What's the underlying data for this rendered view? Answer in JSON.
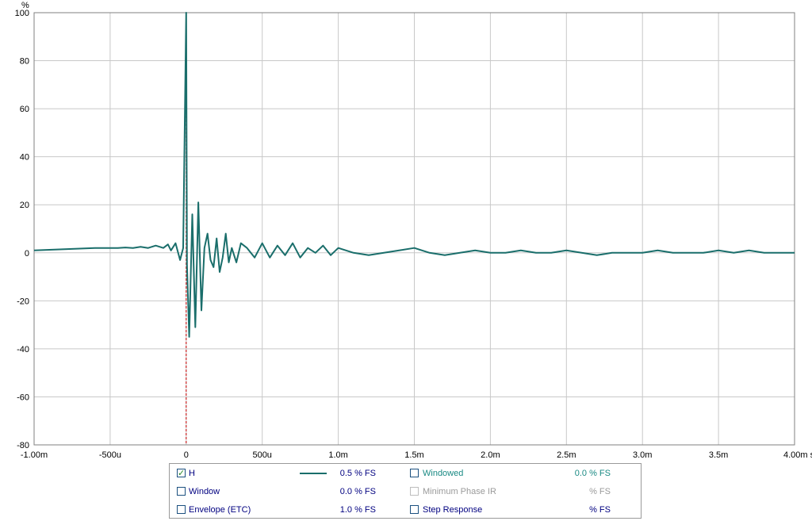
{
  "chart_data": {
    "type": "line",
    "ylabel": "%",
    "x_unit": "s",
    "xlim": [
      -0.001,
      0.004
    ],
    "ylim": [
      -80,
      100
    ],
    "grid": true,
    "x_ticks": [
      {
        "value": -0.001,
        "label": "-1.00m"
      },
      {
        "value": -0.0005,
        "label": "-500u"
      },
      {
        "value": 0,
        "label": "0"
      },
      {
        "value": 0.0005,
        "label": "500u"
      },
      {
        "value": 0.001,
        "label": "1.0m"
      },
      {
        "value": 0.0015,
        "label": "1.5m"
      },
      {
        "value": 0.002,
        "label": "2.0m"
      },
      {
        "value": 0.0025,
        "label": "2.5m"
      },
      {
        "value": 0.003,
        "label": "3.0m"
      },
      {
        "value": 0.0035,
        "label": "3.5m"
      },
      {
        "value": 0.004,
        "label": "4.00m s"
      }
    ],
    "y_ticks": [
      {
        "value": 100,
        "label": "100"
      },
      {
        "value": 80,
        "label": "80"
      },
      {
        "value": 60,
        "label": "60"
      },
      {
        "value": 40,
        "label": "40"
      },
      {
        "value": 20,
        "label": "20"
      },
      {
        "value": 0,
        "label": "0"
      },
      {
        "value": -20,
        "label": "-20"
      },
      {
        "value": -40,
        "label": "-40"
      },
      {
        "value": -60,
        "label": "-60"
      },
      {
        "value": -80,
        "label": "-80"
      }
    ],
    "marker_x": 0,
    "series": [
      {
        "name": "H",
        "color": "#1a6e6b",
        "x": [
          -0.001,
          -0.0008,
          -0.0006,
          -0.0005,
          -0.00045,
          -0.0004,
          -0.00035,
          -0.0003,
          -0.00025,
          -0.0002,
          -0.00015,
          -0.00012,
          -0.0001,
          -7e-05,
          -4e-05,
          -2e-05,
          0,
          5e-06,
          2e-05,
          4e-05,
          6e-05,
          8e-05,
          0.0001,
          0.00012,
          0.00014,
          0.00016,
          0.00018,
          0.0002,
          0.00022,
          0.00024,
          0.00026,
          0.00028,
          0.0003,
          0.00033,
          0.00036,
          0.0004,
          0.00045,
          0.0005,
          0.00055,
          0.0006,
          0.00065,
          0.0007,
          0.00075,
          0.0008,
          0.00085,
          0.0009,
          0.00095,
          0.001,
          0.0011,
          0.0012,
          0.0013,
          0.0014,
          0.0015,
          0.0016,
          0.0017,
          0.0018,
          0.0019,
          0.002,
          0.0021,
          0.0022,
          0.0023,
          0.0024,
          0.0025,
          0.0026,
          0.0027,
          0.0028,
          0.0029,
          0.003,
          0.0031,
          0.0032,
          0.0033,
          0.0034,
          0.0035,
          0.0036,
          0.0037,
          0.0038,
          0.0039,
          0.004
        ],
        "y": [
          1,
          1.5,
          2,
          2,
          2,
          2.2,
          2,
          2.5,
          2,
          3,
          2,
          3.5,
          1,
          4,
          -3,
          2,
          100,
          -5,
          -35,
          16,
          -31,
          21,
          -24,
          2,
          8,
          -3,
          -6,
          6,
          -8,
          -2,
          8,
          -4,
          2,
          -4,
          4,
          2,
          -2,
          4,
          -2,
          3,
          -1,
          4,
          -2,
          2,
          0,
          3,
          -1,
          2,
          0,
          -1,
          0,
          1,
          2,
          0,
          -1,
          0,
          1,
          0,
          0,
          1,
          0,
          0,
          1,
          0,
          -1,
          0,
          0,
          0,
          1,
          0,
          0,
          0,
          1,
          0,
          1,
          0,
          0,
          0
        ]
      }
    ]
  },
  "legend": {
    "items": [
      {
        "label": "H",
        "checked": true,
        "value": "0.5 % FS",
        "label_color": "#000080",
        "value_color": "#000080",
        "swatch": "#1a6e6b"
      },
      {
        "label": "Window",
        "checked": false,
        "value": "0.0 % FS",
        "label_color": "#000080",
        "value_color": "#000080"
      },
      {
        "label": "Envelope (ETC)",
        "checked": false,
        "value": "1.0 % FS",
        "label_color": "#000080",
        "value_color": "#000080"
      },
      {
        "label": "Windowed",
        "checked": false,
        "value": "0.0 % FS",
        "label_color": "#1a8a84",
        "value_color": "#1a8a84"
      },
      {
        "label": "Minimum Phase IR",
        "checked": false,
        "value": "% FS",
        "label_color": "#9a9a9a",
        "value_color": "#9a9a9a"
      },
      {
        "label": "Step Response",
        "checked": false,
        "value": "% FS",
        "label_color": "#000080",
        "value_color": "#000080"
      }
    ]
  }
}
